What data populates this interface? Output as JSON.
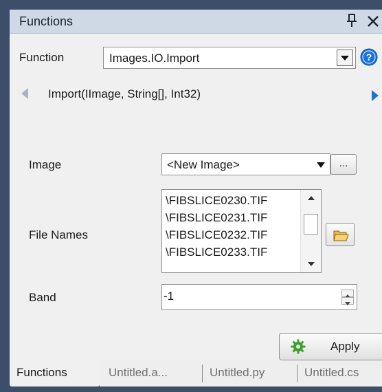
{
  "panel": {
    "title": "Functions"
  },
  "function_row": {
    "label": "Function",
    "value": "Images.IO.Import"
  },
  "signature": "Import(IImage, String[], Int32)",
  "params": {
    "image": {
      "label": "Image",
      "value": "<New Image>",
      "browse_label": "..."
    },
    "file_names": {
      "label": "File Names",
      "files": [
        "\\FIBSLICE0230.TIF",
        "\\FIBSLICE0231.TIF",
        "\\FIBSLICE0232.TIF",
        "\\FIBSLICE0233.TIF"
      ]
    },
    "band": {
      "label": "Band",
      "value": "-1"
    }
  },
  "apply": {
    "label": "Apply"
  },
  "tabs": [
    {
      "label": "Functions",
      "active": true
    },
    {
      "label": "Untitled.a...",
      "active": false
    },
    {
      "label": "Untitled.py",
      "active": false
    },
    {
      "label": "Untitled.cs",
      "active": false
    }
  ],
  "colors": {
    "accent_blue": "#1a73d9",
    "gear_green": "#3aa02a",
    "titlebar": "#cfd9e6",
    "background": "#3c4e6a"
  },
  "icons": [
    "pin-icon",
    "close-icon",
    "help-icon",
    "chevron-left-icon",
    "chevron-right-icon",
    "folder-open-icon",
    "gear-icon",
    "dropdown-arrow-icon"
  ]
}
